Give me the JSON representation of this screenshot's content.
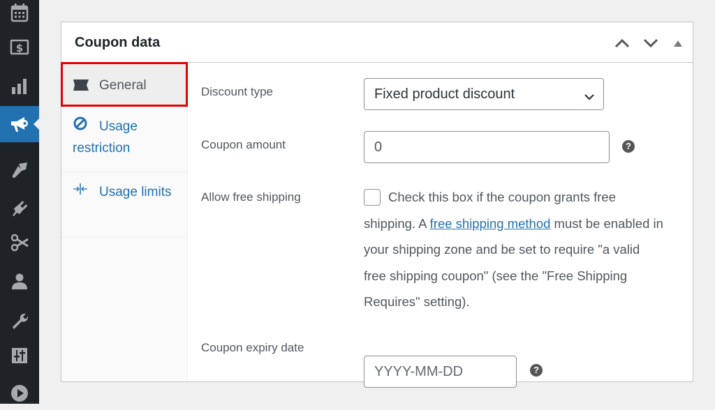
{
  "admin_menu": {
    "items": [
      {
        "icon": "calendar-icon"
      },
      {
        "icon": "money-icon"
      },
      {
        "icon": "analytics-icon"
      },
      {
        "icon": "megaphone-icon",
        "active": true
      },
      {
        "icon": "paintbrush-icon"
      },
      {
        "icon": "plugin-icon"
      },
      {
        "icon": "scissors-icon"
      },
      {
        "icon": "user-icon"
      },
      {
        "icon": "wrench-icon"
      },
      {
        "icon": "settings-sliders-icon"
      },
      {
        "icon": "play-icon"
      }
    ]
  },
  "postbox": {
    "title": "Coupon data",
    "controls": [
      "move-up",
      "move-down",
      "toggle-panel"
    ]
  },
  "tabs": [
    {
      "label": "General",
      "icon": "ticket-icon",
      "active": true
    },
    {
      "label": "Usage restriction",
      "icon": "block-icon",
      "active": false
    },
    {
      "label": "Usage limits",
      "icon": "limits-icon",
      "active": false
    }
  ],
  "fields": {
    "discount_type": {
      "label": "Discount type",
      "value": "Fixed product discount"
    },
    "coupon_amount": {
      "label": "Coupon amount",
      "value": "0"
    },
    "free_shipping": {
      "label": "Allow free shipping",
      "checked": false,
      "desc_before": "Check this box if the coupon grants free shipping. A ",
      "link_text": "free shipping method",
      "desc_after": " must be enabled in your shipping zone and be set to require \"a valid free shipping coupon\" (see the \"Free Shipping Requires\" setting)."
    },
    "expiry_date": {
      "label": "Coupon expiry date",
      "placeholder": "YYYY-MM-DD",
      "value": ""
    }
  },
  "help_glyph": "?"
}
